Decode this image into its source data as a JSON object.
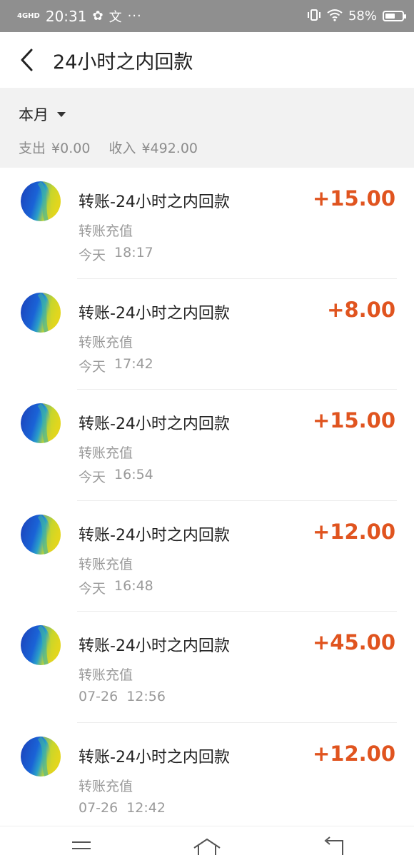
{
  "status_bar": {
    "network": "4GHD",
    "time": "20:31",
    "dots": "···",
    "battery": "58%",
    "battery_level": 0.58
  },
  "header": {
    "title": "24小时之内回款",
    "back_icon": "chevron-left-icon"
  },
  "summary": {
    "month_label": "本月",
    "expense_label": "支出",
    "expense_value": "¥0.00",
    "income_label": "收入",
    "income_value": "¥492.00"
  },
  "transactions": [
    {
      "title": "转账-24小时之内回款",
      "subtitle": "转账充值",
      "date": "今天",
      "time": "18:17",
      "amount": "+15.00"
    },
    {
      "title": "转账-24小时之内回款",
      "subtitle": "转账充值",
      "date": "今天",
      "time": "17:42",
      "amount": "+8.00"
    },
    {
      "title": "转账-24小时之内回款",
      "subtitle": "转账充值",
      "date": "今天",
      "time": "16:54",
      "amount": "+15.00"
    },
    {
      "title": "转账-24小时之内回款",
      "subtitle": "转账充值",
      "date": "今天",
      "time": "16:48",
      "amount": "+12.00"
    },
    {
      "title": "转账-24小时之内回款",
      "subtitle": "转账充值",
      "date": "07-26",
      "time": "12:56",
      "amount": "+45.00"
    },
    {
      "title": "转账-24小时之内回款",
      "subtitle": "转账充值",
      "date": "07-26",
      "time": "12:42",
      "amount": "+12.00"
    }
  ],
  "colors": {
    "status_bar_bg": "#8f8f8f",
    "summary_bg": "#f2f2f2",
    "amount": "#e0541f"
  },
  "nav": {
    "menu_icon": "menu-icon",
    "home_icon": "home-icon",
    "back_icon": "back-arrow-icon"
  }
}
